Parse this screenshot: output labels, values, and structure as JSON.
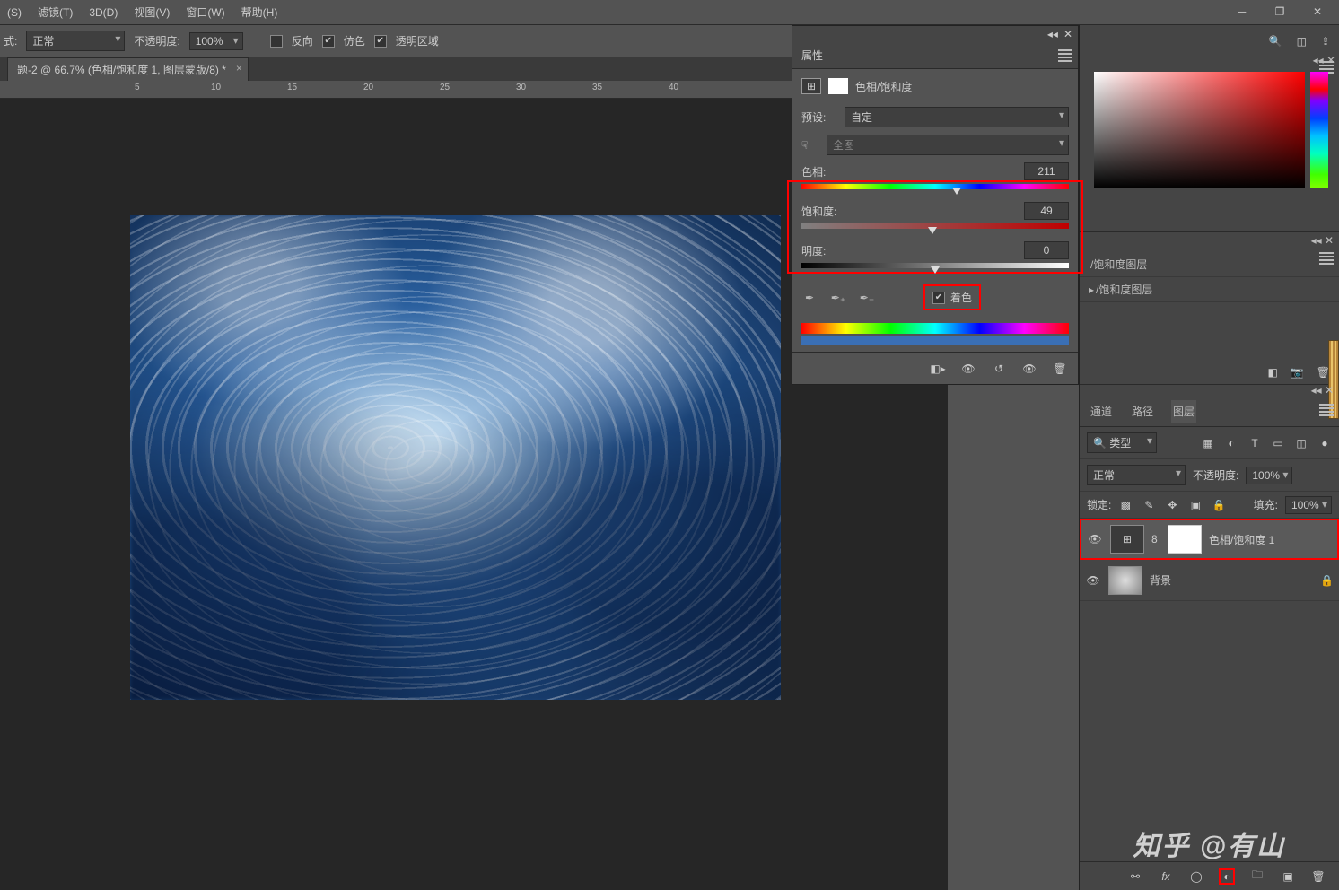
{
  "menu": {
    "items": [
      "(S)",
      "滤镜(T)",
      "3D(D)",
      "视图(V)",
      "窗口(W)",
      "帮助(H)"
    ]
  },
  "options": {
    "mode_label": "式:",
    "mode_value": "正常",
    "opacity_label": "不透明度:",
    "opacity_value": "100%",
    "reverse": "反向",
    "dither": "仿色",
    "transp": "透明区域"
  },
  "tab": {
    "title": "题-2 @ 66.7% (色相/饱和度 1, 图层蒙版/8) *"
  },
  "ruler": [
    "5",
    "10",
    "15",
    "20",
    "25",
    "30",
    "35",
    "40"
  ],
  "properties": {
    "panel_title": "属性",
    "sub_label": "色相/饱和度",
    "preset_label": "预设:",
    "preset_value": "自定",
    "range_value": "全图",
    "hue_label": "色相:",
    "hue_value": "211",
    "sat_label": "饱和度:",
    "sat_value": "49",
    "lit_label": "明度:",
    "lit_value": "0",
    "colorize": "着色"
  },
  "mid": {
    "item1": "/饱和度图层",
    "item2": "/饱和度图层"
  },
  "layers": {
    "tabs": [
      "通道",
      "路径",
      "图层"
    ],
    "kind": "类型",
    "blend": "正常",
    "opacity_label": "不透明度:",
    "opacity_value": "100%",
    "lock_label": "锁定:",
    "fill_label": "填充:",
    "fill_value": "100%",
    "l1": "色相/饱和度 1",
    "l2": "背景"
  },
  "watermark": "知乎 @有山"
}
